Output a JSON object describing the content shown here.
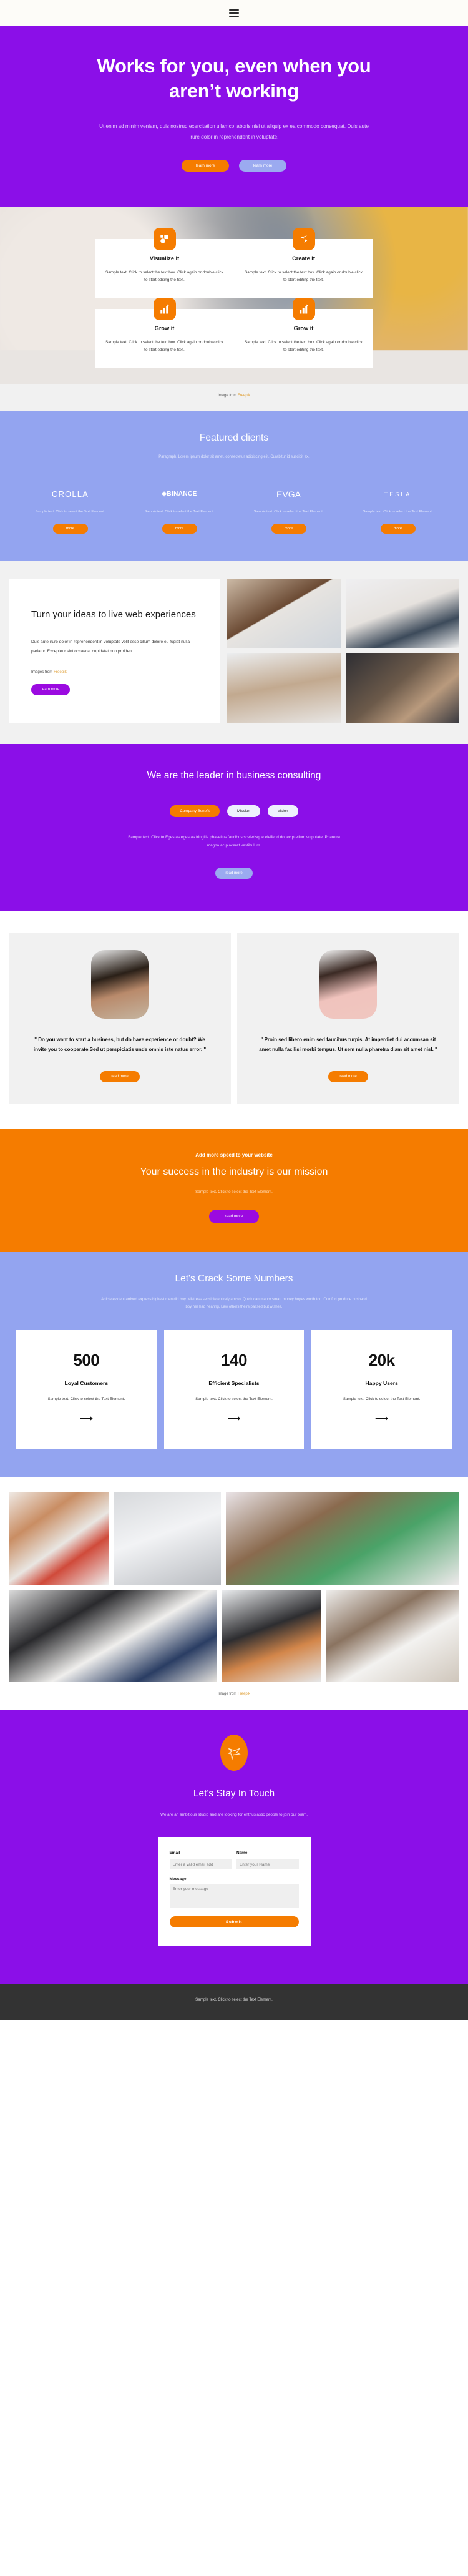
{
  "header": {
    "menu_icon": "hamburger-menu-icon"
  },
  "hero": {
    "title": "Works for you, even when you aren’t working",
    "paragraph": "Ut enim ad minim veniam, quis nostrud exercitation ullamco laboris nisi ut aliquip ex ea commodo consequat. Duis aute irure dolor in reprehenderit in voluptate.",
    "primary_btn": "learn more",
    "secondary_btn": "learn more"
  },
  "features": {
    "body_text": "Sample text. Click to select the text box. Click again or double click to start editing the text.",
    "cards": [
      {
        "title": "Visualize it",
        "icon": "shapes-icon"
      },
      {
        "title": "Create it",
        "icon": "node-share-icon"
      },
      {
        "title": "Grow it",
        "icon": "bar-chart-growth-icon"
      },
      {
        "title": "Grow it",
        "icon": "bar-chart-growth-icon"
      }
    ],
    "credit_prefix": "Image from ",
    "credit_link": "Freepik"
  },
  "clients": {
    "title": "Featured clients",
    "subtitle": "Paragraph. Lorem ipsum dolor sit amet, consectetur adipiscing elit. Curabitur id suscipit ex.",
    "item_text": "Sample text. Click to select the Text Element.",
    "button": "more",
    "logos": [
      "CROLLA",
      "BINANCE",
      "EVGA",
      "TESLA"
    ]
  },
  "ideas": {
    "title": "Turn your ideas to live web experiences",
    "paragraph": "Duis aute irure dolor in reprehenderit in voluptate velit esse cillum dolore eu fugiat nulla pariatur. Excepteur sint occaecat cupidatat non proident",
    "credit_prefix": "Images from ",
    "credit_link": "Freepik",
    "button": "learn more"
  },
  "leader": {
    "title": "We are the leader in business consulting",
    "tabs": [
      "Company Benefit",
      "Mission",
      "Vision"
    ],
    "active_tab": "Company Benefit",
    "paragraph": "Sample text. Click to Egestas egestas fringilla phasellus faucibus scelerisque eleifend donec pretium vulputate. Pharetra magna ac placerat vestibulum.",
    "button": "read more"
  },
  "testimonials": {
    "items": [
      {
        "quote": "\" Do you want to start a business, but do have experience or doubt? We invite you to cooperate.Sed ut perspiciatis unde omnis iste natus error. \"",
        "button": "read more"
      },
      {
        "quote": "\" Proin sed libero enim sed faucibus turpis. At imperdiet dui accumsan sit amet nulla facilisi morbi tempus. Ut sem nulla pharetra diam sit amet nisl. \"",
        "button": "read more"
      }
    ]
  },
  "cta": {
    "kicker": "Add more speed to your website",
    "title": "Your success in the industry is our mission",
    "paragraph": "Sample text. Click to select the Text Element.",
    "button": "read more"
  },
  "numbers": {
    "title": "Let's Crack Some Numbers",
    "intro": "Article evident arrived express highest men did boy. Mistress sensible entirely am so. Quick can manor smart money hopes worth too. Comfort produce husband boy her had hearing. Law others theirs passed but wishes.",
    "cards": [
      {
        "value": "500",
        "label": "Loyal Customers",
        "desc": "Sample text. Click to select the Text Element.",
        "arrow": "arrow-right-icon"
      },
      {
        "value": "140",
        "label": "Efficient Specialists",
        "desc": "Sample text. Click to select the Text Element.",
        "arrow": "arrow-right-icon"
      },
      {
        "value": "20k",
        "label": "Happy Users",
        "desc": "Sample text. Click to select the Text Element.",
        "arrow": "arrow-right-icon"
      }
    ]
  },
  "gallery": {
    "credit_prefix": "Image from ",
    "credit_link": "Freepik"
  },
  "contact": {
    "logo_icon": "origami-bird-icon",
    "title": "Let's Stay In Touch",
    "lead": "We are an ambitious studio and are looking for enthusiastic people to join our team.",
    "form": {
      "email_label": "Email",
      "email_placeholder": "Enter a valid email add",
      "email_value": "",
      "name_label": "Name",
      "name_placeholder": "Enter your Name",
      "name_value": "",
      "message_label": "Message",
      "message_placeholder": "Enter your message",
      "message_value": "",
      "submit": "Submit"
    }
  },
  "footer": {
    "text": "Sample text. Click to select the Text Element."
  },
  "colors": {
    "purple": "#8B0FE8",
    "orange": "#F57C00",
    "periwinkle": "#93A4F0",
    "light_grey": "#f1f1f1",
    "footer_dark": "#333333"
  }
}
